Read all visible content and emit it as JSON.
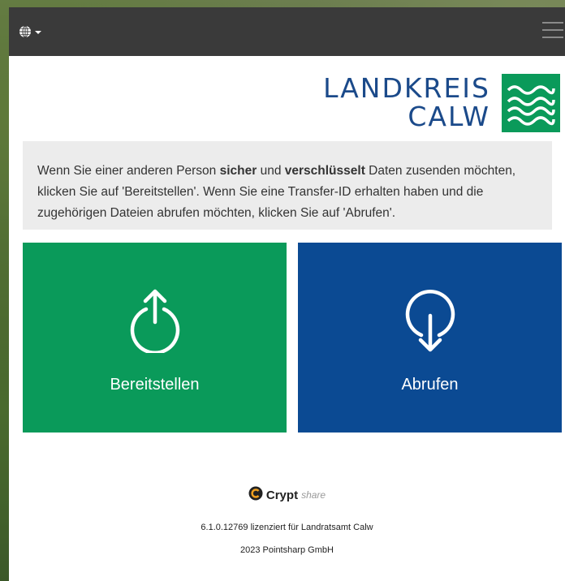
{
  "colors": {
    "topbar": "#3a3a3a",
    "provide_tile": "#0a9a5a",
    "retrieve_tile": "#0b4a93",
    "logo_blue": "#1b4a8a",
    "logo_green": "#0a9a5a"
  },
  "header": {
    "language_icon": "globe-icon",
    "menu_icon": "hamburger-icon"
  },
  "logo": {
    "line1": "LANDKREIS",
    "line2": "CALW"
  },
  "intro": {
    "part1": "Wenn Sie einer anderen Person ",
    "bold1": "sicher",
    "part2": " und ",
    "bold2": "verschlüsselt",
    "part3": " Daten zusenden möchten, klicken Sie auf 'Bereitstellen'. Wenn Sie eine Transfer-ID erhalten haben und die zugehörigen Dateien abrufen möchten, klicken Sie auf 'Abrufen'."
  },
  "actions": {
    "provide_label": "Bereitstellen",
    "provide_icon": "upload-icon",
    "retrieve_label": "Abrufen",
    "retrieve_icon": "download-icon"
  },
  "footer": {
    "brand_bold": "Crypt",
    "brand_light": "share",
    "version_text": "6.1.0.12769 lizenziert für Landratsamt Calw",
    "copyright": "2023 Pointsharp GmbH"
  }
}
